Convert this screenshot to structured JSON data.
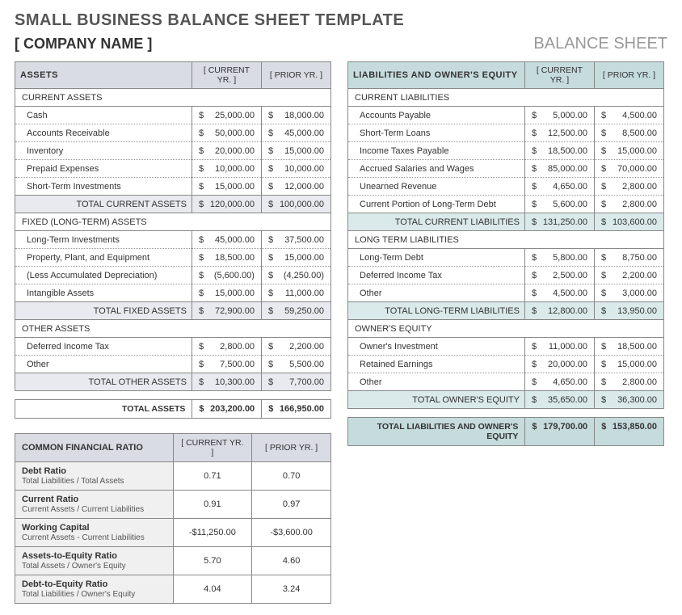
{
  "page_title": "SMALL BUSINESS BALANCE SHEET TEMPLATE",
  "company_name": "[ COMPANY NAME ]",
  "doc_type": "BALANCE SHEET",
  "col_current": "[ CURRENT YR. ]",
  "col_prior": "[ PRIOR YR. ]",
  "assets": {
    "header": "ASSETS",
    "current": {
      "title": "CURRENT ASSETS",
      "rows": [
        {
          "label": "Cash",
          "cur": "25,000.00",
          "pri": "18,000.00"
        },
        {
          "label": "Accounts Receivable",
          "cur": "50,000.00",
          "pri": "45,000.00"
        },
        {
          "label": "Inventory",
          "cur": "20,000.00",
          "pri": "15,000.00"
        },
        {
          "label": "Prepaid Expenses",
          "cur": "10,000.00",
          "pri": "10,000.00"
        },
        {
          "label": "Short-Term Investments",
          "cur": "15,000.00",
          "pri": "12,000.00"
        }
      ],
      "total_label": "TOTAL CURRENT ASSETS",
      "total_cur": "120,000.00",
      "total_pri": "100,000.00"
    },
    "fixed": {
      "title": "FIXED (LONG-TERM) ASSETS",
      "rows": [
        {
          "label": "Long-Term Investments",
          "cur": "45,000.00",
          "pri": "37,500.00"
        },
        {
          "label": "Property, Plant, and Equipment",
          "cur": "18,500.00",
          "pri": "15,000.00"
        },
        {
          "label": "(Less Accumulated Depreciation)",
          "cur": "(5,600.00)",
          "pri": "(4,250.00)"
        },
        {
          "label": "Intangible Assets",
          "cur": "15,000.00",
          "pri": "11,000.00"
        }
      ],
      "total_label": "TOTAL FIXED ASSETS",
      "total_cur": "72,900.00",
      "total_pri": "59,250.00"
    },
    "other": {
      "title": "OTHER ASSETS",
      "rows": [
        {
          "label": "Deferred Income Tax",
          "cur": "2,800.00",
          "pri": "2,200.00"
        },
        {
          "label": "Other",
          "cur": "7,500.00",
          "pri": "5,500.00"
        }
      ],
      "total_label": "TOTAL OTHER ASSETS",
      "total_cur": "10,300.00",
      "total_pri": "7,700.00"
    },
    "grand_label": "TOTAL ASSETS",
    "grand_cur": "203,200.00",
    "grand_pri": "166,950.00"
  },
  "liab": {
    "header": "LIABILITIES AND OWNER'S EQUITY",
    "current": {
      "title": "CURRENT LIABILITIES",
      "rows": [
        {
          "label": "Accounts Payable",
          "cur": "5,000.00",
          "pri": "4,500.00"
        },
        {
          "label": "Short-Term Loans",
          "cur": "12,500.00",
          "pri": "8,500.00"
        },
        {
          "label": "Income Taxes Payable",
          "cur": "18,500.00",
          "pri": "15,000.00"
        },
        {
          "label": "Accrued Salaries and Wages",
          "cur": "85,000.00",
          "pri": "70,000.00"
        },
        {
          "label": "Unearned Revenue",
          "cur": "4,650.00",
          "pri": "2,800.00"
        },
        {
          "label": "Current Portion of Long-Term Debt",
          "cur": "5,600.00",
          "pri": "2,800.00"
        }
      ],
      "total_label": "TOTAL CURRENT LIABILITIES",
      "total_cur": "131,250.00",
      "total_pri": "103,600.00"
    },
    "longterm": {
      "title": "LONG TERM LIABILITIES",
      "rows": [
        {
          "label": "Long-Term Debt",
          "cur": "5,800.00",
          "pri": "8,750.00"
        },
        {
          "label": "Deferred Income Tax",
          "cur": "2,500.00",
          "pri": "2,200.00"
        },
        {
          "label": "Other",
          "cur": "4,500.00",
          "pri": "3,000.00"
        }
      ],
      "total_label": "TOTAL LONG-TERM LIABILITIES",
      "total_cur": "12,800.00",
      "total_pri": "13,950.00"
    },
    "equity": {
      "title": "OWNER'S EQUITY",
      "rows": [
        {
          "label": "Owner's Investment",
          "cur": "11,000.00",
          "pri": "18,500.00"
        },
        {
          "label": "Retained Earnings",
          "cur": "20,000.00",
          "pri": "15,000.00"
        },
        {
          "label": "Other",
          "cur": "4,650.00",
          "pri": "2,800.00"
        }
      ],
      "total_label": "TOTAL OWNER'S EQUITY",
      "total_cur": "35,650.00",
      "total_pri": "36,300.00"
    },
    "grand_label": "TOTAL LIABILITIES AND OWNER'S EQUITY",
    "grand_cur": "179,700.00",
    "grand_pri": "153,850.00"
  },
  "ratios": {
    "header": "COMMON FINANCIAL RATIO",
    "rows": [
      {
        "name": "Debt Ratio",
        "desc": "Total Liabilities / Total Assets",
        "cur": "0.71",
        "pri": "0.70"
      },
      {
        "name": "Current Ratio",
        "desc": "Current Assets / Current Liabilities",
        "cur": "0.91",
        "pri": "0.97"
      },
      {
        "name": "Working Capital",
        "desc": "Current Assets - Current Liabilities",
        "cur": "-$11,250.00",
        "pri": "-$3,600.00"
      },
      {
        "name": "Assets-to-Equity Ratio",
        "desc": "Total Assets / Owner's Equity",
        "cur": "5.70",
        "pri": "4.60"
      },
      {
        "name": "Debt-to-Equity Ratio",
        "desc": "Total Liabilities / Owner's Equity",
        "cur": "4.04",
        "pri": "3.24"
      }
    ]
  }
}
